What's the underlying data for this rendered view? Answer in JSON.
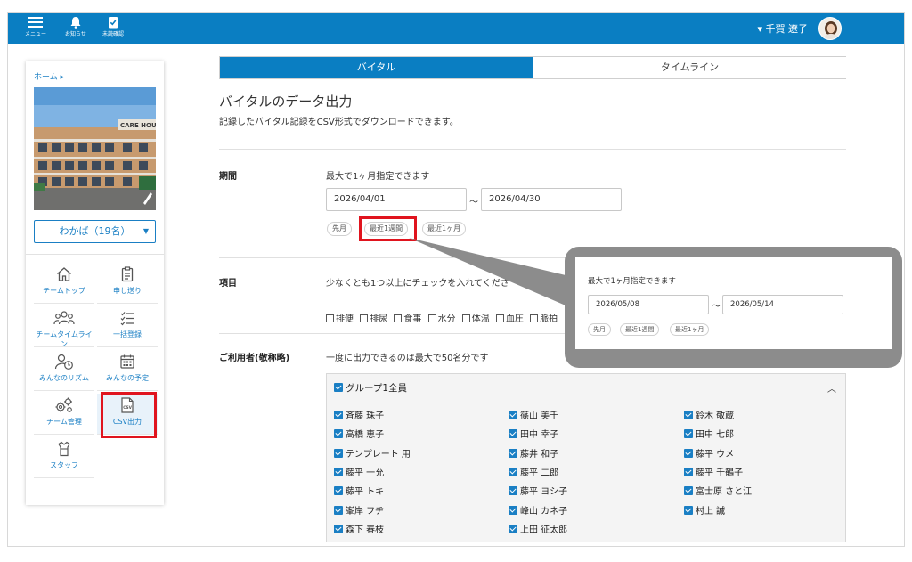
{
  "topbar": {
    "menu_label": "メニュー",
    "notice_label": "お知らせ",
    "unconfirmed_label": "未読確認",
    "user_name": "▾ 千賀 遼子",
    "bg_color": "#0a7ec2"
  },
  "sidebar": {
    "breadcrumb": "ホーム ▸",
    "photo_sign": "CARE HOUS",
    "team_select": "わかば（19名）",
    "nav": [
      {
        "label": "チームトップ",
        "icon": "home-icon"
      },
      {
        "label": "申し送り",
        "icon": "clipboard-icon"
      },
      {
        "label": "チームタイムライン",
        "icon": "group-icon"
      },
      {
        "label": "一括登録",
        "icon": "checklist-icon"
      },
      {
        "label": "みんなのリズム",
        "icon": "person-clock-icon"
      },
      {
        "label": "みんなの予定",
        "icon": "calendar-icon"
      },
      {
        "label": "チーム管理",
        "icon": "gears-icon"
      },
      {
        "label": "CSV出力",
        "icon": "csv-file-icon"
      },
      {
        "label": "スタッフ",
        "icon": "apron-icon"
      }
    ]
  },
  "tabs": {
    "active": "バイタル",
    "inactive": "タイムライン"
  },
  "page": {
    "title": "バイタルのデータ出力",
    "subtitle": "記録したバイタル記録をCSV形式でダウンロードできます。"
  },
  "period": {
    "label": "期間",
    "note": "最大で1ヶ月指定できます",
    "from": "2026/04/01",
    "to": "2026/04/30",
    "tilde": "〜",
    "presets": [
      "先月",
      "最近1週間",
      "最近1ヶ月"
    ]
  },
  "items": {
    "label": "項目",
    "note": "少なくとも1つ以上にチェックを入れてくださ",
    "options": [
      "排便",
      "排尿",
      "食事",
      "水分",
      "体温",
      "血圧",
      "脈拍"
    ]
  },
  "users": {
    "label": "ご利用者(敬称略)",
    "note": "一度に出力できるのは最大で50名分です",
    "group": "グループ1全員",
    "col1": [
      "斉藤 珠子",
      "高橋 恵子",
      "テンプレート 用",
      "藤平 一允",
      "藤平 トキ",
      "峯岸 フヂ",
      "森下 春枝"
    ],
    "col2": [
      "篠山 美千",
      "田中 幸子",
      "藤井 和子",
      "藤平 二郎",
      "藤平 ヨシ子",
      "峰山 カネ子",
      "上田 征太郎"
    ],
    "col3": [
      "鈴木 敬蔵",
      "田中 七郎",
      "藤平 ウメ",
      "藤平 千鶴子",
      "富士原 さと江",
      "村上 誠"
    ]
  },
  "callout": {
    "note": "最大で1ヶ月指定できます",
    "from": "2026/05/08",
    "to": "2026/05/14",
    "tilde": "〜",
    "presets": [
      "先月",
      "最近1週間",
      "最近1ヶ月"
    ]
  },
  "colors": {
    "accent": "#0a7ec2",
    "highlight": "#e0141e",
    "callout": "#8c8c8c"
  }
}
